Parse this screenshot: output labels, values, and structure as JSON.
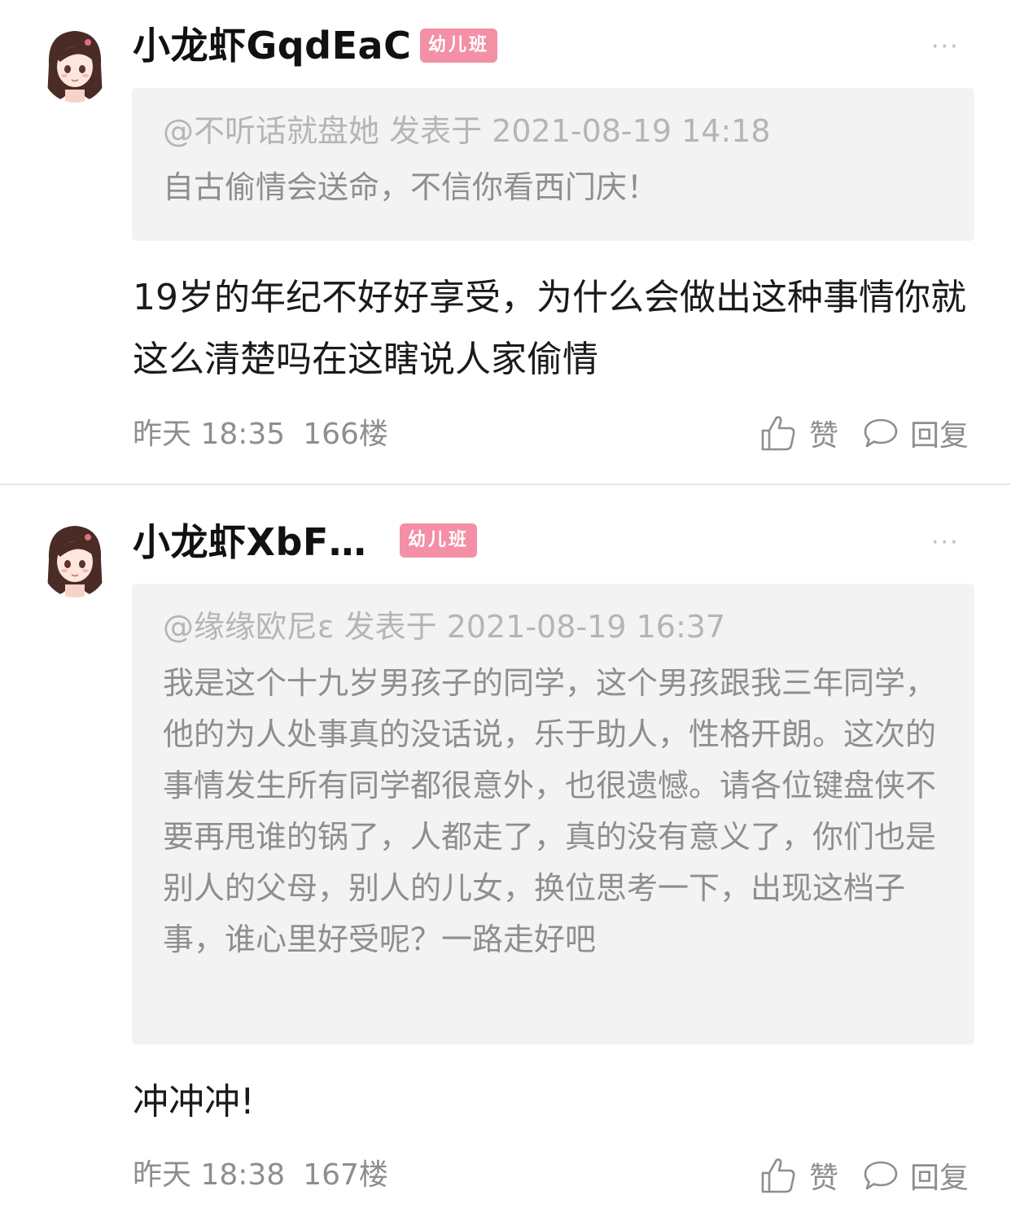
{
  "comments": [
    {
      "username": "小龙虾GqdEaC",
      "badge": "幼儿班",
      "more": "···",
      "quote": {
        "header": "@不听话就盘她 发表于 2021-08-19 14:18",
        "text": "自古偷情会送命，不信你看西门庆！"
      },
      "body": "19岁的年纪不好好享受，为什么会做出这种事情你就这么清楚吗在这瞎说人家偷情",
      "time": "昨天 18:35",
      "floor": "166楼",
      "like_label": "赞",
      "reply_label": "回复"
    },
    {
      "username": "小龙虾XbF…",
      "badge": "幼儿班",
      "more": "···",
      "quote": {
        "header": "@缘缘欧尼ε 发表于 2021-08-19 16:37",
        "text": "我是这个十九岁男孩子的同学，这个男孩跟我三年同学，他的为人处事真的没话说，乐于助人，性格开朗。这次的事情发生所有同学都很意外，也很遗憾。请各位键盘侠不要再甩谁的锅了，人都走了，真的没有意义了，你们也是别人的父母，别人的儿女，换位思考一下，出现这档子事，谁心里好受呢？一路走好吧"
      },
      "body": "冲冲冲!",
      "time": "昨天 18:38",
      "floor": "167楼",
      "like_label": "赞",
      "reply_label": "回复"
    }
  ],
  "colors": {
    "badge": "#f390a6",
    "quote_bg": "#f3f3f3",
    "meta": "#8e8e8e"
  },
  "icons": {
    "avatar": "cartoon-girl-avatar",
    "like": "thumbs-up-icon",
    "reply": "speech-bubble-icon",
    "more": "more-dots-icon"
  }
}
